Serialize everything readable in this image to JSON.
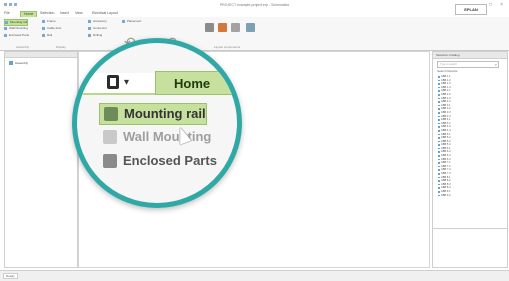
{
  "window": {
    "title": "PROJECT example-project.erp - Schematics"
  },
  "tabs": [
    {
      "label": "File"
    },
    {
      "label": "Home"
    },
    {
      "label": "Selection"
    },
    {
      "label": "Insert"
    },
    {
      "label": "View"
    },
    {
      "label": "Electrical Layout"
    }
  ],
  "ribbon": {
    "groups": [
      {
        "label": "Assembly"
      },
      {
        "label": "Display"
      },
      {
        "label": "Layout components"
      }
    ],
    "buttons": [
      {
        "label": "Mounting rail"
      },
      {
        "label": "Wall Mounting"
      },
      {
        "label": "Enclosed Parts"
      }
    ]
  },
  "magnifier": {
    "home_tab": "Home",
    "items": [
      {
        "label": "Mounting rail"
      },
      {
        "label": "Wall Mounting"
      },
      {
        "label": "Enclosed Parts"
      }
    ]
  },
  "left_panel": {
    "tree_root": "Assembly"
  },
  "right_panel": {
    "title": "Selection Catalog",
    "search_placeholder": "Type to search",
    "caption": "Search Results",
    "items": [
      "ABB 1.1",
      "ABB 1.2",
      "ABB 1.3",
      "ABB 1.4",
      "ABB 2.1",
      "ABB 2.2",
      "ABB 2.3",
      "ABB 2.4",
      "ABB 3.1",
      "ABB 3.2",
      "ABB 3.3",
      "ABB 3.4",
      "ABB 4.1",
      "ABB 4.2",
      "ABB 4.3",
      "ABB 4.4",
      "ABB 5.1",
      "ABB 5.2",
      "ABB 5.3",
      "ABB 5.4",
      "ABB 6.1",
      "ABB 6.2",
      "ABB 6.3",
      "ABB 6.4",
      "ABB 7.1",
      "ABB 7.2",
      "ABB 7.3",
      "ABB 7.4",
      "ABB 8.1",
      "ABB 8.2",
      "ABB 8.3",
      "ABB 8.4",
      "ABB 9.1",
      "ABB 9.2"
    ],
    "no_data": "No data available"
  },
  "status": {
    "label": "Ready"
  },
  "colors": {
    "accent_green": "#c6e09e",
    "ring_teal": "#30a9a6"
  },
  "icons": [
    "app-menu-icon",
    "undo-icon",
    "redo-icon",
    "mounting-rail-icon",
    "wall-mounting-icon",
    "enclosed-parts-icon",
    "mouse-cursor-icon",
    "search-icon"
  ]
}
